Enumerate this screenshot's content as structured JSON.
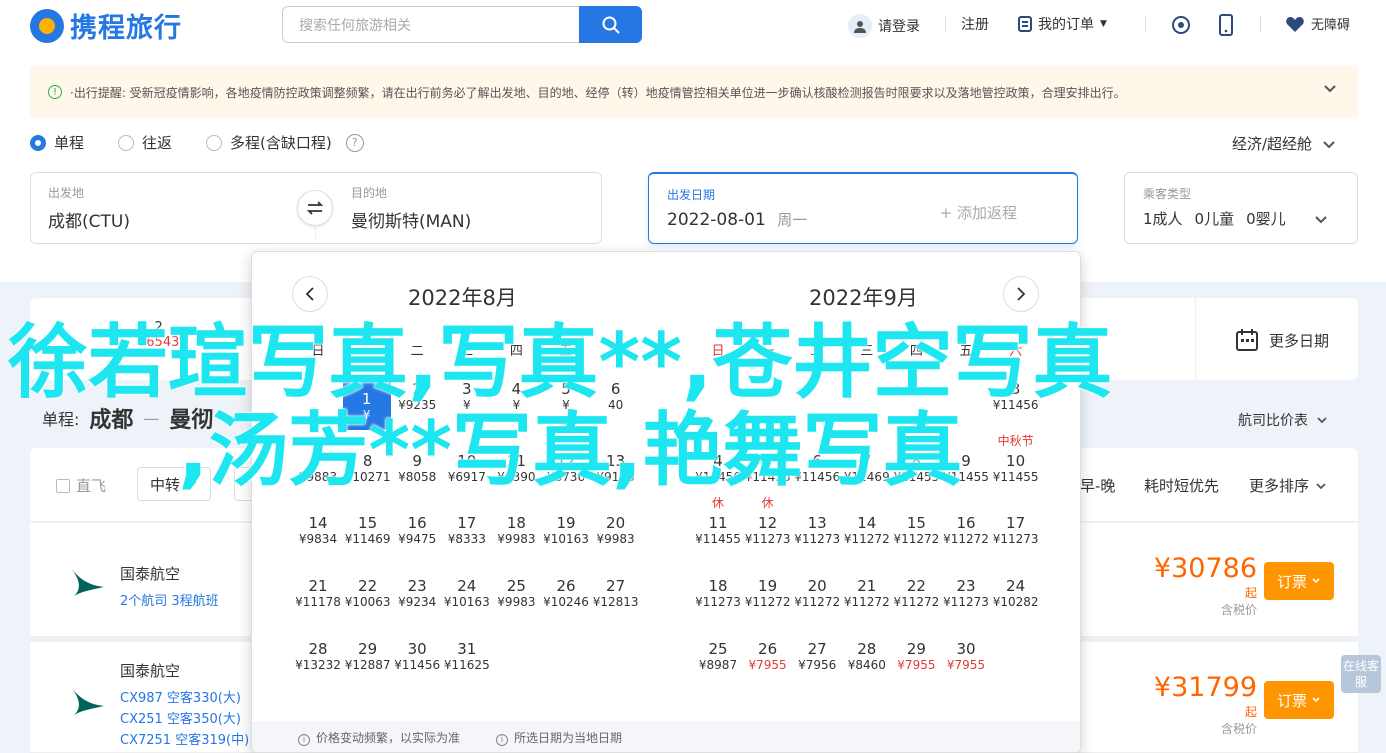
{
  "header": {
    "logo_text": "携程旅行",
    "search_placeholder": "搜索任何旅游相关",
    "login": "请登录",
    "register": "注册",
    "my_orders": "我的订单",
    "accessibility": "无障碍"
  },
  "notice": {
    "text": "·出行提醒: 受新冠疫情影响，各地疫情防控政策调整频繁，请在出行前务必了解出发地、目的地、经停（转）地疫情管控相关单位进一步确认核酸检测报告时限要求以及落地管控政策，合理安排出行。"
  },
  "trip_type": {
    "options": [
      "单程",
      "往返",
      "多程(含缺口程)"
    ],
    "cabin": "经济/超经舱"
  },
  "search": {
    "from_label": "出发地",
    "from_value": "成都(CTU)",
    "to_label": "目的地",
    "to_value": "曼彻斯特(MAN)",
    "date_label": "出发日期",
    "date_value": "2022-08-01",
    "date_weekday": "周一",
    "add_return": "+ 添加返程",
    "pax_label": "乘客类型",
    "pax_adult": "1成人",
    "pax_child": "0儿童",
    "pax_infant": "0婴儿"
  },
  "cheap_bar": {
    "more_dates": "更多日期",
    "visible_day": "2",
    "visible_price": "¥6543"
  },
  "route": {
    "label": "单程:",
    "from": "成都",
    "to": "曼彻",
    "compare": "航司比价表"
  },
  "filters": {
    "direct": "直飞",
    "transfer": "中转",
    "early_late": "早-晚",
    "short_first": "耗时短优先",
    "more_sort": "更多排序"
  },
  "flights": [
    {
      "airline": "国泰航空",
      "info": "2个航司  3程航班",
      "price": "¥30786",
      "price_suffix": "起",
      "tax": "含税价",
      "book": "订票"
    },
    {
      "airline": "国泰航空",
      "segments": [
        "CX987 空客330(大)",
        "CX251 空客350(大)",
        "CX7251 空客319(中)"
      ],
      "price": "¥31799",
      "price_suffix": "起",
      "tax": "含税价",
      "book": "订票"
    }
  ],
  "online_service": "在线客服",
  "calendar": {
    "left_title": "2022年8月",
    "right_title": "2022年9月",
    "weekdays": [
      "日",
      "一",
      "二",
      "三",
      "四",
      "五",
      "六"
    ],
    "august": [
      {
        "d": "1",
        "p": "¥"
      },
      {
        "d": "2",
        "p": "¥9235"
      },
      {
        "d": "3",
        "p": "¥"
      },
      {
        "d": "4",
        "p": "¥"
      },
      {
        "d": "5",
        "p": "¥"
      },
      {
        "d": "6",
        "p": "40"
      },
      {
        "d": "7",
        "p": "¥9883"
      },
      {
        "d": "8",
        "p": "¥10271"
      },
      {
        "d": "9",
        "p": "¥8058"
      },
      {
        "d": "10",
        "p": "¥6917"
      },
      {
        "d": "11",
        "p": "¥8390"
      },
      {
        "d": "12",
        "p": "¥8736"
      },
      {
        "d": "13",
        "p": "¥9156"
      },
      {
        "d": "14",
        "p": "¥9834"
      },
      {
        "d": "15",
        "p": "¥11469"
      },
      {
        "d": "16",
        "p": "¥9475"
      },
      {
        "d": "17",
        "p": "¥8333"
      },
      {
        "d": "18",
        "p": "¥9983"
      },
      {
        "d": "19",
        "p": "¥10163"
      },
      {
        "d": "20",
        "p": "¥9983"
      },
      {
        "d": "21",
        "p": "¥11178"
      },
      {
        "d": "22",
        "p": "¥10063"
      },
      {
        "d": "23",
        "p": "¥9234"
      },
      {
        "d": "24",
        "p": "¥10163"
      },
      {
        "d": "25",
        "p": "¥9983"
      },
      {
        "d": "26",
        "p": "¥10246"
      },
      {
        "d": "27",
        "p": "¥12813"
      },
      {
        "d": "28",
        "p": "¥13232"
      },
      {
        "d": "29",
        "p": "¥12887"
      },
      {
        "d": "30",
        "p": "¥11456"
      },
      {
        "d": "31",
        "p": "¥11625"
      }
    ],
    "september": [
      {
        "d": "3",
        "p": "¥11456"
      },
      {
        "d": "4",
        "p": "¥11456"
      },
      {
        "d": "5",
        "p": "¥11456"
      },
      {
        "d": "6",
        "p": "¥11456"
      },
      {
        "d": "7",
        "p": "¥11469"
      },
      {
        "d": "8",
        "p": "¥11455"
      },
      {
        "d": "9",
        "p": "¥11455"
      },
      {
        "d": "10",
        "p": "¥11455"
      },
      {
        "d": "11",
        "p": "¥11455"
      },
      {
        "d": "12",
        "p": "¥11273"
      },
      {
        "d": "13",
        "p": "¥11273"
      },
      {
        "d": "14",
        "p": "¥11272"
      },
      {
        "d": "15",
        "p": "¥11272"
      },
      {
        "d": "16",
        "p": "¥11272"
      },
      {
        "d": "17",
        "p": "¥11273"
      },
      {
        "d": "18",
        "p": "¥11273"
      },
      {
        "d": "19",
        "p": "¥11272"
      },
      {
        "d": "20",
        "p": "¥11272"
      },
      {
        "d": "21",
        "p": "¥11272"
      },
      {
        "d": "22",
        "p": "¥11272"
      },
      {
        "d": "23",
        "p": "¥11273"
      },
      {
        "d": "24",
        "p": "¥10282"
      },
      {
        "d": "25",
        "p": "¥8987"
      },
      {
        "d": "26",
        "p": "¥7955"
      },
      {
        "d": "27",
        "p": "¥7956"
      },
      {
        "d": "28",
        "p": "¥8460"
      },
      {
        "d": "29",
        "p": "¥7955"
      },
      {
        "d": "30",
        "p": "¥7955"
      }
    ],
    "holiday_tag": "休",
    "festival_tag": "中秋节",
    "foot_note_1": "价格变动频繁，以实际为准",
    "foot_note_2": "所选日期为当地日期"
  },
  "overlay": {
    "line1": "徐若瑄写真,写真**,苍井空写真",
    "line2": ",汤芳**写真,艳舞写真"
  },
  "colors": {
    "brand": "#2577e3",
    "accent_orange": "#ff9500",
    "price": "#ff6600",
    "overlay": "#1ee6f0"
  }
}
